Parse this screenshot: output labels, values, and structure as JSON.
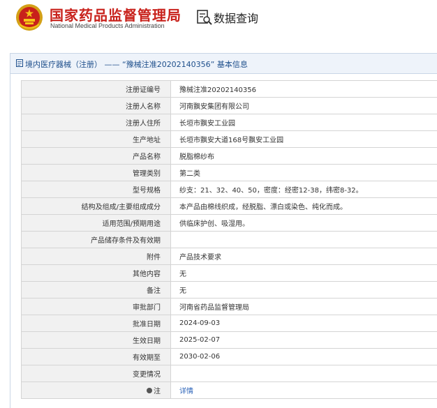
{
  "header": {
    "agency_cn": "国家药品监督管理局",
    "agency_en": "National Medical Products Administration",
    "query_title": "数据查询"
  },
  "panel": {
    "title": "境内医疗器械（注册） —— “豫械注准20202140356” 基本信息"
  },
  "rows": [
    {
      "label": "注册证编号",
      "value": "豫械注准20202140356"
    },
    {
      "label": "注册人名称",
      "value": "河南飘安集团有限公司"
    },
    {
      "label": "注册人住所",
      "value": "长垣市飘安工业园"
    },
    {
      "label": "生产地址",
      "value": "长垣市飘安大道168号飘安工业园"
    },
    {
      "label": "产品名称",
      "value": "脱脂棉纱布"
    },
    {
      "label": "管理类别",
      "value": "第二类"
    },
    {
      "label": "型号规格",
      "value": "纱支：21、32、40、50，密度：经密12-38，纬密8-32。"
    },
    {
      "label": "结构及组成/主要组成成分",
      "value": "本产品由棉线织成，经脱脂、漂白或染色、纯化而成。"
    },
    {
      "label": "适用范围/预期用途",
      "value": "供临床护创、吸湿用。"
    },
    {
      "label": "产品储存条件及有效期",
      "value": ""
    },
    {
      "label": "附件",
      "value": "产品技术要求"
    },
    {
      "label": "其他内容",
      "value": "无"
    },
    {
      "label": "备注",
      "value": "无"
    },
    {
      "label": "审批部门",
      "value": "河南省药品监督管理局"
    },
    {
      "label": "批准日期",
      "value": "2024-09-03"
    },
    {
      "label": "生效日期",
      "value": "2025-02-07"
    },
    {
      "label": "有效期至",
      "value": "2030-02-06"
    },
    {
      "label": "变更情况",
      "value": ""
    },
    {
      "label": "注",
      "value": "详情"
    }
  ],
  "colors": {
    "brand_red": "#c8211b",
    "title_blue": "#1d4e8b",
    "link_blue": "#2a62b8"
  },
  "icons": [
    "national-emblem-icon",
    "search-document-icon",
    "document-icon",
    "note-icon"
  ]
}
